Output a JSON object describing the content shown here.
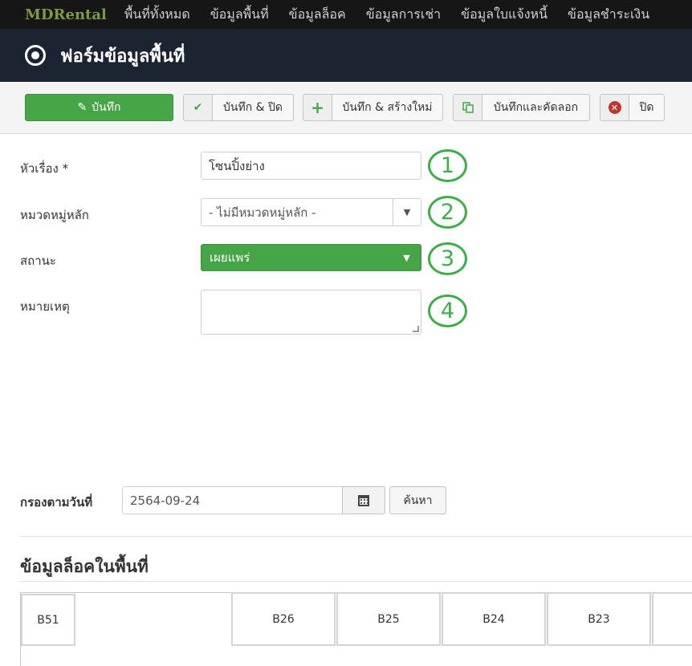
{
  "nav": {
    "brand": "MDRental",
    "items": [
      "พื้นที่ทั้งหมด",
      "ข้อมูลพื้นที่",
      "ข้อมูลล็อค",
      "ข้อมูลการเช่า",
      "ข้อมูลใบแจ้งหนี้",
      "ข้อมูลชำระเงิน"
    ]
  },
  "header": {
    "title": "ฟอร์มข้อมูลพื้นที่",
    "icon": "target-icon"
  },
  "toolbar": {
    "save": "บันทึก",
    "save_close": "บันทึก & ปิด",
    "save_new": "บันทึก & สร้างใหม่",
    "save_copy": "บันทึกและคัดลอก",
    "close": "ปิด"
  },
  "form": {
    "title_label": "หัวเรื่อง *",
    "title_value": "โซนปิ้งย่าง",
    "category_label": "หมวดหมู่หลัก",
    "category_value": "- ไม่มีหมวดหมู่หลัก -",
    "status_label": "สถานะ",
    "status_value": "เผยแพร่",
    "note_label": "หมายเหตุ",
    "note_value": ""
  },
  "callouts": [
    "1",
    "2",
    "3",
    "4"
  ],
  "filter": {
    "label": "กรองตามวันที่",
    "date_value": "2564-09-24",
    "search_label": "ค้นหา"
  },
  "locks": {
    "title": "ข้อมูลล็อคในพื้นที่",
    "items": [
      "B51",
      "B26",
      "B25",
      "B24",
      "B23"
    ]
  },
  "colors": {
    "accent_green": "#46a546",
    "callout_green": "#3fae49",
    "nav_bg": "#161616",
    "title_bg": "#1c2331"
  }
}
